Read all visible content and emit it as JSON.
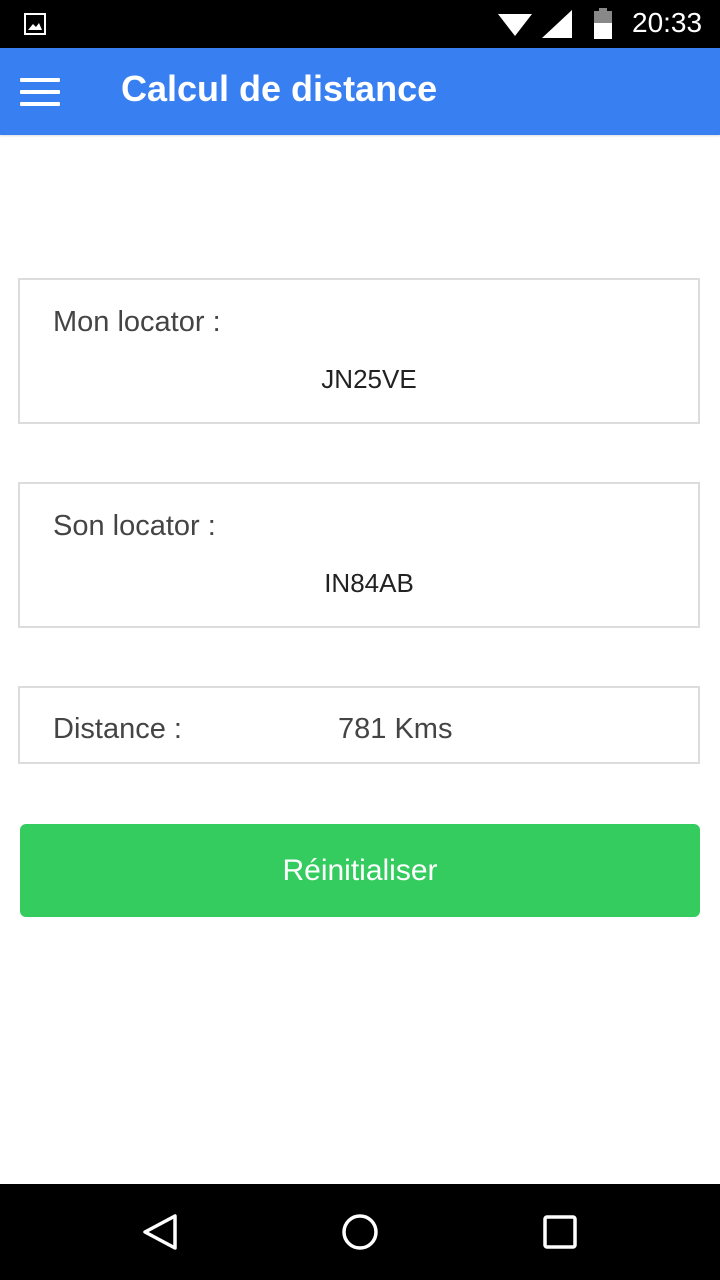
{
  "status_bar": {
    "time": "20:33",
    "icons": [
      "image-notification-icon",
      "wifi-icon",
      "cell-signal-icon",
      "battery-icon"
    ]
  },
  "app_bar": {
    "title": "Calcul de distance",
    "menu_icon": "hamburger-menu-icon",
    "color": "#3880f2"
  },
  "form": {
    "my_locator": {
      "label": "Mon locator :",
      "value": "JN25VE"
    },
    "their_locator": {
      "label": "Son locator :",
      "value": "IN84AB"
    },
    "distance": {
      "label": "Distance :",
      "value": "781 Kms"
    },
    "reset_button": {
      "label": "Réinitialiser",
      "color": "#35cc5f"
    }
  },
  "nav_bar": {
    "icons": [
      "back-icon",
      "home-icon",
      "recents-icon"
    ]
  }
}
